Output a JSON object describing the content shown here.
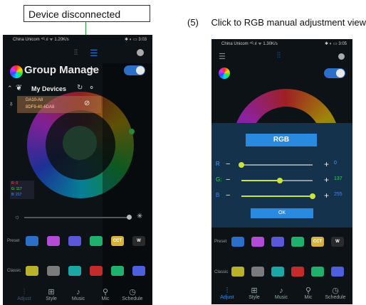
{
  "annotation": {
    "callout_text": "Device disconnected",
    "step_number": "(5)",
    "step_text": "Click to RGB manual adjustment view"
  },
  "phone_left": {
    "status_left": "China Unicom ⁴ᴳ.ıl ᯤ 1.20K/s",
    "status_right": "✱ ◐ ▭ 3:03",
    "group_title": "Group Manage",
    "plus": "+",
    "my_devices": "My Devices",
    "device_name": "DA10-A8",
    "device_mac": "8DF9-40-6DA8",
    "rgb_readouts": [
      "R: 0",
      "G: 117",
      "B: 217"
    ],
    "presets": [
      {
        "label": "Preset",
        "chips": [
          "#2c6fc9",
          "#b24bd6",
          "#5b57d8",
          "#1fb06e",
          "CCT",
          "W"
        ]
      },
      {
        "label": "Classic",
        "chips": [
          "#b8b22a",
          "#7b7b7b",
          "#1aa7a6",
          "#c42c2c",
          "#1fb06e",
          "#4d5fdc"
        ]
      }
    ],
    "tabs": [
      {
        "icon": "⫶",
        "label": "Adjust"
      },
      {
        "icon": "⊞",
        "label": "Style"
      },
      {
        "icon": "♪",
        "label": "Music"
      },
      {
        "icon": "⚲",
        "label": "Mic"
      },
      {
        "icon": "◷",
        "label": "Schedule"
      }
    ],
    "colors": {
      "accent": "#2c6fc9",
      "wheel_center": "#1f3b2b"
    }
  },
  "phone_right": {
    "status_left": "China Unicom ⁴ᴳ.ıl ᯤ 1.30K/s",
    "status_right": "✱ ◐ ▭ 3:05",
    "dialog_title": "RGB",
    "sliders": [
      {
        "label": "R",
        "value_text": "0",
        "level": 0.0,
        "color": "#4aa0ff"
      },
      {
        "label": "G:",
        "value_text": "137",
        "level": 0.54,
        "color": "#3fd05a"
      },
      {
        "label": "B",
        "value_text": "255",
        "level": 1.0,
        "color": "#4a7cff"
      }
    ],
    "ok": "OK",
    "preset_label": "Preset",
    "classic_label": "Classic",
    "preset_chips": [
      "#2c6fc9",
      "#b24bd6",
      "#5b57d8",
      "#1fb06e",
      "CCT",
      "W"
    ],
    "classic_chips": [
      "#b8b22a",
      "#7b7b7b",
      "#1aa7a6",
      "#c42c2c",
      "#1fb06e",
      "#4d5fdc"
    ],
    "tabs": [
      {
        "icon": "⫶",
        "label": "Adjust"
      },
      {
        "icon": "⊞",
        "label": "Style"
      },
      {
        "icon": "♪",
        "label": "Music"
      },
      {
        "icon": "⚲",
        "label": "Mic"
      },
      {
        "icon": "◷",
        "label": "Schedule"
      }
    ],
    "colors": {
      "active_tab": "#3a8fe0",
      "dialog_bg": "#15324d"
    }
  }
}
